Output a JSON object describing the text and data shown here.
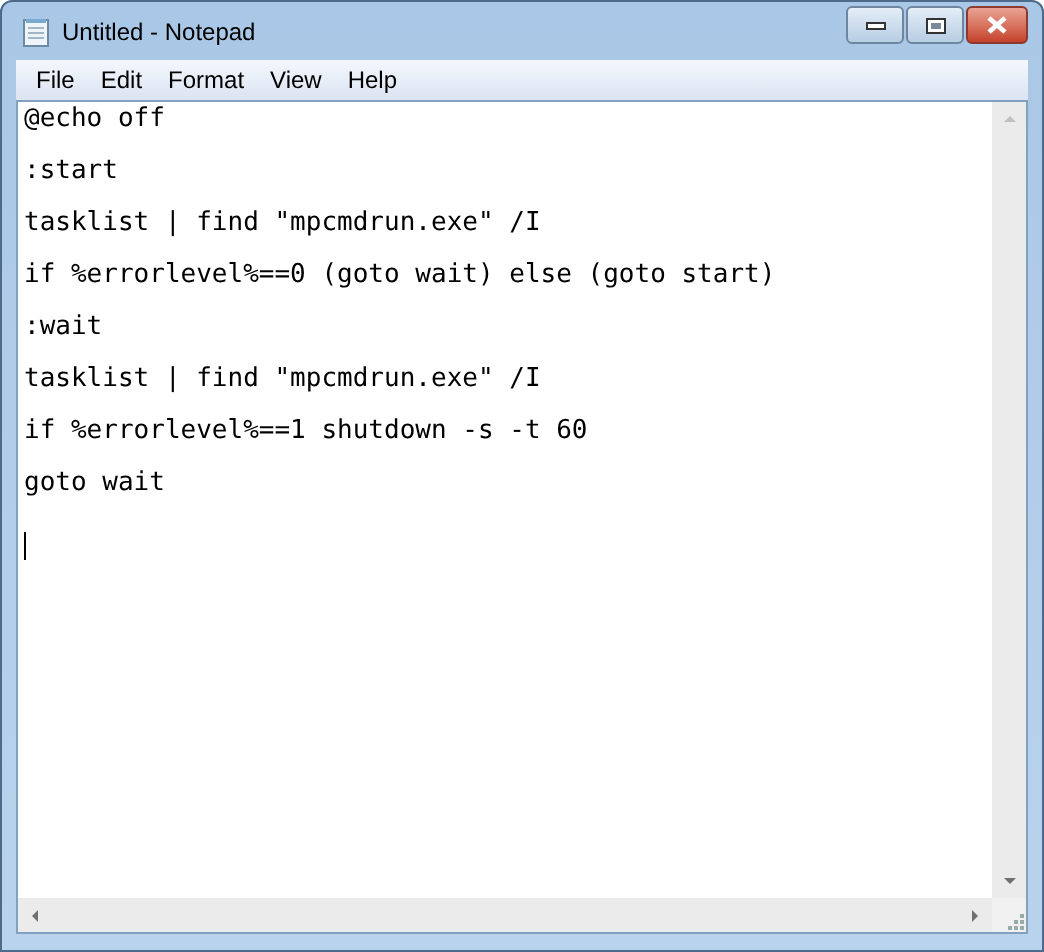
{
  "window": {
    "title": "Untitled - Notepad"
  },
  "menu": [
    "File",
    "Edit",
    "Format",
    "View",
    "Help"
  ],
  "editor": {
    "lines": [
      "@echo off",
      ":start",
      "tasklist | find \"mpcmdrun.exe\" /I",
      "if %errorlevel%==0 (goto wait) else (goto start)",
      ":wait",
      "tasklist | find \"mpcmdrun.exe\" /I",
      "if %errorlevel%==1 shutdown -s -t 60",
      "goto wait"
    ]
  }
}
